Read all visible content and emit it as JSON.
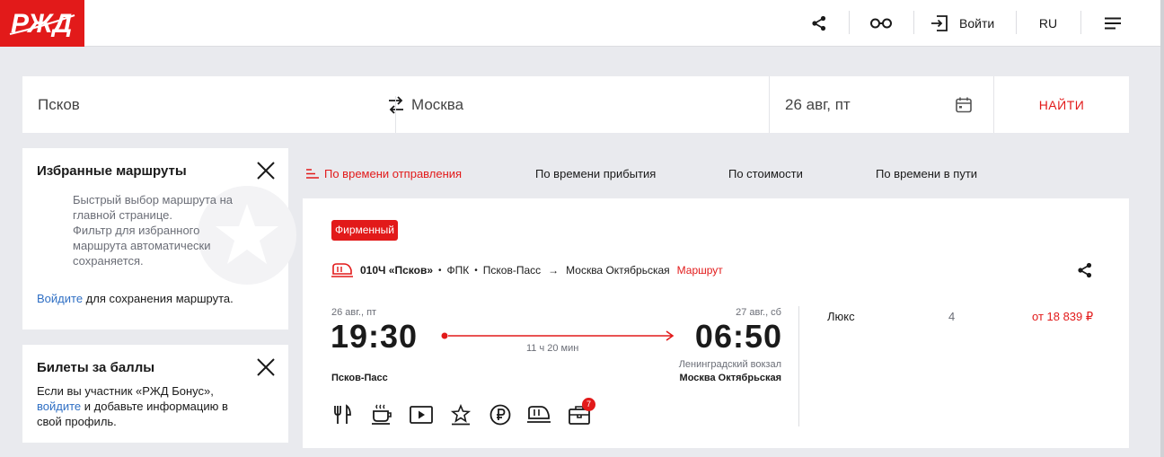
{
  "header": {
    "login_label": "Войти",
    "lang_label": "RU",
    "logo_text": "РЖД"
  },
  "search": {
    "from": "Псков",
    "to": "Москва",
    "date": "26 авг, пт",
    "find_label": "НАЙТИ"
  },
  "favorites_card": {
    "title": "Избранные маршруты",
    "line1": "Быстрый выбор маршрута на",
    "line2": "главной странице.",
    "line3": "Фильтр для избранного",
    "line4": "маршрута автоматически",
    "line5": "сохраняется.",
    "login_link": "Войдите",
    "login_rest": " для сохранения маршрута."
  },
  "bonus_card": {
    "title": "Билеты за баллы",
    "line1": "Если вы участник «РЖД Бонус»,",
    "link": "войдите",
    "line2_rest": " и добавьте информацию в",
    "line3": "свой профиль."
  },
  "sort": {
    "by_departure": "По времени отправления",
    "by_arrival": "По времени прибытия",
    "by_price": "По стоимости",
    "by_duration": "По времени в пути"
  },
  "train": {
    "badge": "Фирменный",
    "number_name": "010Ч «Псков»",
    "carrier": "ФПК",
    "from_station": "Псков-Пасс",
    "to_station": "Москва Октябрьская",
    "route_link": "Маршрут",
    "dep_date": "26 авг., пт",
    "dep_time": "19:30",
    "arr_date": "27 авг., сб",
    "arr_time": "06:50",
    "duration": "11 ч 20 мин",
    "dep_station_name": "Псков-Пасс",
    "arr_terminal": "Ленинградский вокзал",
    "arr_station_name": "Москва Октябрьская",
    "class_name": "Люкс",
    "seats": "4",
    "price": "от 18 839 ₽",
    "amenity_badge": "7"
  },
  "colors": {
    "brand_red": "#e21a1a",
    "link_blue": "#2f6fc4",
    "background": "#e9eaee"
  }
}
